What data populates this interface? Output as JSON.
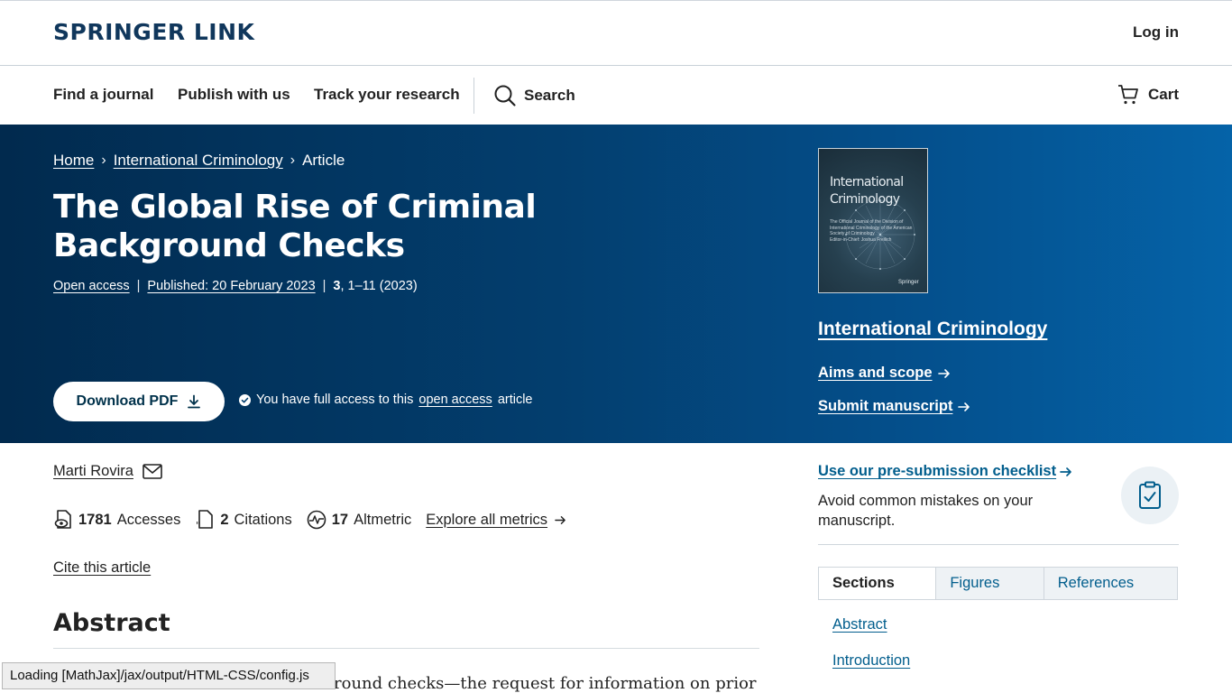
{
  "header": {
    "logo": "SPRINGER LINK",
    "login": "Log in"
  },
  "nav": {
    "items": [
      "Find a journal",
      "Publish with us",
      "Track your research"
    ],
    "search": "Search",
    "cart": "Cart"
  },
  "breadcrumb": [
    "Home",
    "International Criminology",
    "Article"
  ],
  "article": {
    "title": "The Global Rise of Criminal Background Checks",
    "access": "Open access",
    "published": "Published: 20 February 2023",
    "volume": "3",
    "pages": ", 1–11 (2023)",
    "download_label": "Download PDF",
    "access_note_prefix": "You have full access to this",
    "access_note_link": "open access",
    "access_note_suffix": "article"
  },
  "journal": {
    "cover_title_line1": "International",
    "cover_title_line2": "Criminology",
    "cover_subtitle": "The Official Journal of the Division of International Criminology of the American Society of Criminology",
    "cover_editor": "Editor-in-Chief: Joshua Freilich",
    "cover_publisher": "Springer",
    "name": "International Criminology",
    "aims": "Aims and scope",
    "submit": "Submit manuscript"
  },
  "authors": [
    "Marti Rovira"
  ],
  "metrics": {
    "accesses_count": "1781",
    "accesses_label": "Accesses",
    "citations_count": "2",
    "citations_label": "Citations",
    "altmetric_count": "17",
    "altmetric_label": "Altmetric",
    "explore": "Explore all metrics"
  },
  "cite": "Cite this article",
  "abstract": {
    "heading": "Abstract",
    "text_fragment": "round checks—the request for information on prior"
  },
  "status_bar": "Loading [MathJax]/jax/output/HTML-CSS/config.js",
  "sidebar": {
    "checklist_link": "Use our pre-submission checklist",
    "checklist_desc": "Avoid common mistakes on your manuscript.",
    "tabs": [
      "Sections",
      "Figures",
      "References"
    ],
    "sections": [
      "Abstract",
      "Introduction"
    ]
  },
  "colors": {
    "brand": "#10375c",
    "hero_start": "#012a4e",
    "hero_end": "#0563a8",
    "link": "#025e8d"
  }
}
